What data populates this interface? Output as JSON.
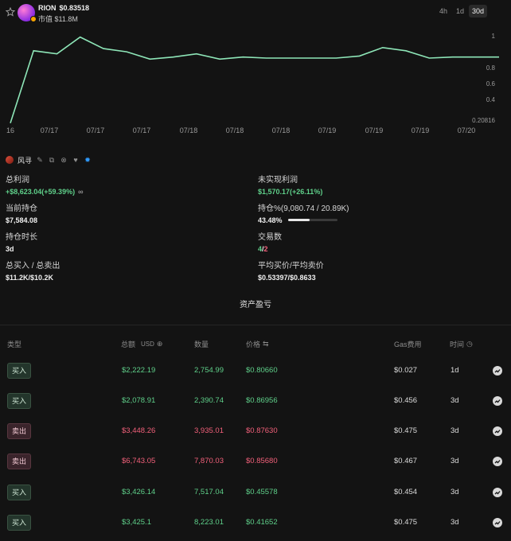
{
  "token": {
    "symbol": "RION",
    "price": "$0.83518",
    "market_cap": "市值 $11.8M",
    "colors": {
      "accent": "#5fd08a",
      "negative": "#f2607a"
    }
  },
  "timeframes": [
    {
      "label": "4h",
      "active": false
    },
    {
      "label": "1d",
      "active": false
    },
    {
      "label": "30d",
      "active": true
    }
  ],
  "chart_data": {
    "type": "line",
    "y_ticks": [
      "1",
      "0.8",
      "0.6",
      "0.4",
      "0.20816"
    ],
    "x_ticks": [
      "16",
      "07/17",
      "07/17",
      "07/17",
      "07/18",
      "07/18",
      "07/18",
      "07/19",
      "07/19",
      "07/19",
      "07/20"
    ],
    "ylim": [
      0.20816,
      1.05
    ],
    "values": [
      0.21,
      0.9,
      0.87,
      1.03,
      0.92,
      0.89,
      0.82,
      0.84,
      0.87,
      0.82,
      0.84,
      0.83,
      0.83,
      0.83,
      0.83,
      0.85,
      0.93,
      0.9,
      0.83,
      0.84,
      0.84,
      0.84
    ],
    "line_color": "#8ee6b8",
    "grid": false
  },
  "user": {
    "name": "风寻",
    "icons": [
      "edit-icon",
      "copy-icon",
      "x-icon",
      "heart-icon",
      "verified-icon"
    ]
  },
  "stats": {
    "total_profit": {
      "label": "总利润",
      "value": "+$8,623.04(+59.39%)"
    },
    "unrealized": {
      "label": "未实现利润",
      "value": "$1,570.17(+26.11%)"
    },
    "holding": {
      "label": "当前持仓",
      "value": "$7,584.08"
    },
    "holding_pct": {
      "label": "持仓%(9,080.74 / 20.89K)",
      "value": "43.48%",
      "fraction": 0.4348
    },
    "hold_time": {
      "label": "持仓时长",
      "value": "3d"
    },
    "trades": {
      "label": "交易数",
      "buys": "4",
      "sep": "/",
      "sells": "2"
    },
    "buy_sell_total": {
      "label": "总买入 / 总卖出",
      "value": "$11.2K/$10.2K"
    },
    "avg_prices": {
      "label": "平均买价/平均卖价",
      "value": "$0.53397/$0.8633"
    }
  },
  "section_title": "资产盈亏",
  "table": {
    "headers": {
      "type": "类型",
      "total": "总额",
      "total_unit": "USD",
      "qty": "数量",
      "price": "价格",
      "gas": "Gas费用",
      "time": "时间"
    },
    "rows": [
      {
        "type": "买入",
        "side": "buy",
        "total": "$2,222.19",
        "qty": "2,754.99",
        "price": "$0.80660",
        "gas": "$0.027",
        "time": "1d"
      },
      {
        "type": "买入",
        "side": "buy",
        "total": "$2,078.91",
        "qty": "2,390.74",
        "price": "$0.86956",
        "gas": "$0.456",
        "time": "3d"
      },
      {
        "type": "卖出",
        "side": "sell",
        "total": "$3,448.26",
        "qty": "3,935.01",
        "price": "$0.87630",
        "gas": "$0.475",
        "time": "3d"
      },
      {
        "type": "卖出",
        "side": "sell",
        "total": "$6,743.05",
        "qty": "7,870.03",
        "price": "$0.85680",
        "gas": "$0.467",
        "time": "3d"
      },
      {
        "type": "买入",
        "side": "buy",
        "total": "$3,426.14",
        "qty": "7,517.04",
        "price": "$0.45578",
        "gas": "$0.454",
        "time": "3d"
      },
      {
        "type": "买入",
        "side": "buy",
        "total": "$3,425.1",
        "qty": "8,223.01",
        "price": "$0.41652",
        "gas": "$0.475",
        "time": "3d"
      }
    ]
  }
}
